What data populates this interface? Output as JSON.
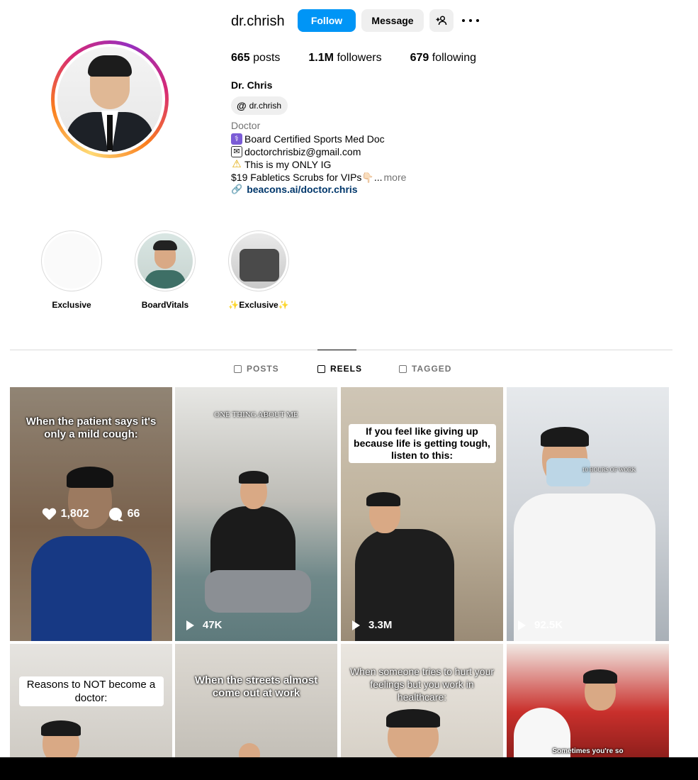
{
  "profile": {
    "username": "dr.chrish",
    "follow_label": "Follow",
    "message_label": "Message",
    "stats": {
      "posts_count": "665",
      "posts_label": "posts",
      "followers_count": "1.1M",
      "followers_label": "followers",
      "following_count": "679",
      "following_label": "following"
    },
    "full_name": "Dr. Chris",
    "threads_handle": "dr.chrish",
    "category": "Doctor",
    "bio_lines": [
      "Board Certified Sports Med Doc",
      "doctorchrisbiz@gmail.com",
      "This is my ONLY IG",
      "$19 Fabletics Scrubs for VIPs👇🏻..."
    ],
    "bio_more": "more",
    "link": "beacons.ai/doctor.chris"
  },
  "highlights": [
    {
      "label": "Exclusive"
    },
    {
      "label": "BoardVitals"
    },
    {
      "label": "✨Exclusive✨"
    }
  ],
  "tabs": {
    "posts": "POSTS",
    "reels": "REELS",
    "tagged": "TAGGED"
  },
  "reels": [
    {
      "caption": "When the patient says it's only a mild cough:",
      "likes": "1,802",
      "comments": "66"
    },
    {
      "caption": "ONE THING ABOUT ME",
      "views": "47K"
    },
    {
      "caption": "If you feel like giving up because life is getting tough, listen to this:",
      "views": "3.3M"
    },
    {
      "caption": "10 HOURS OF WORK",
      "views": "92.5K"
    },
    {
      "caption": "Reasons to NOT become a doctor:"
    },
    {
      "caption": "When the streets almost come out at work"
    },
    {
      "caption": "When someone tries to hurt your feelings but you work in healthcare:"
    },
    {
      "caption": "Sometimes you're so"
    }
  ],
  "colors": {
    "follow_blue": "#0095f6",
    "link_blue": "#00376b",
    "muted_gray": "#737373"
  }
}
